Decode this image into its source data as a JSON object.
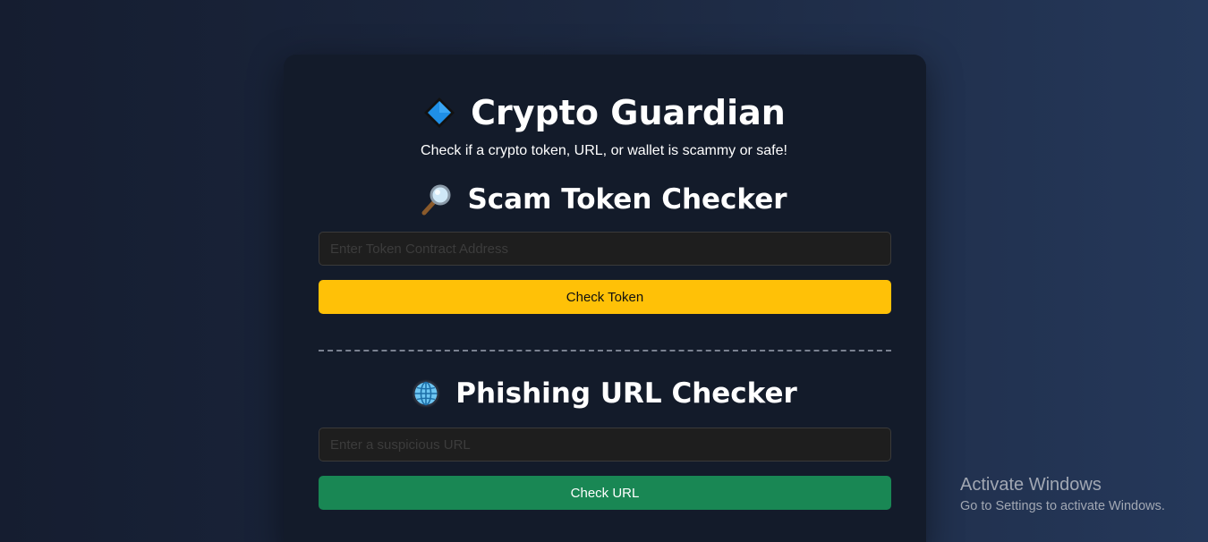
{
  "header": {
    "title": "Crypto Guardian",
    "title_icon": "blue-diamond-icon",
    "subtitle": "Check if a crypto token, URL, or wallet is scammy or safe!"
  },
  "token_checker": {
    "heading": "Scam Token Checker",
    "heading_icon": "magnifying-glass-icon",
    "input_placeholder": "Enter Token Contract Address",
    "input_value": "",
    "button_label": "Check Token"
  },
  "url_checker": {
    "heading": "Phishing URL Checker",
    "heading_icon": "globe-icon",
    "input_placeholder": "Enter a suspicious URL",
    "input_value": "",
    "button_label": "Check URL"
  },
  "watermark": {
    "title": "Activate Windows",
    "subtitle": "Go to Settings to activate Windows."
  },
  "colors": {
    "background_left": "#151d30",
    "background_right": "#25385a",
    "card": "#131b2a",
    "token_button": "#ffc107",
    "url_button": "#198754",
    "input_bg": "#1e1e1e"
  }
}
